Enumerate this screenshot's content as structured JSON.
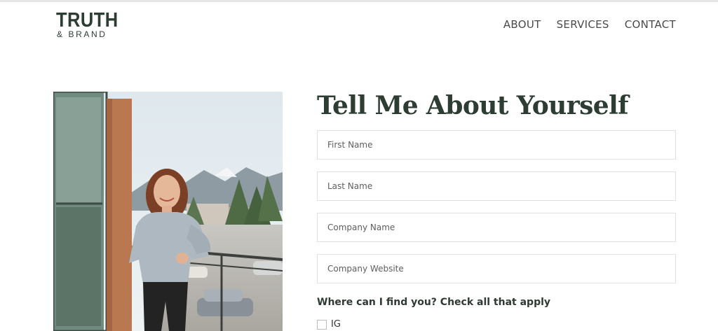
{
  "brand": {
    "name_main": "TRUTH",
    "name_sub": "& BRAND"
  },
  "nav": {
    "items": [
      {
        "label": "ABOUT"
      },
      {
        "label": "SERVICES"
      },
      {
        "label": "CONTACT"
      }
    ]
  },
  "form": {
    "title": "Tell Me About Yourself",
    "fields": {
      "first_name": {
        "placeholder": "First Name",
        "value": ""
      },
      "last_name": {
        "placeholder": "Last Name",
        "value": ""
      },
      "company_name": {
        "placeholder": "Company Name",
        "value": ""
      },
      "company_website": {
        "placeholder": "Company Website",
        "value": ""
      }
    },
    "question": "Where can I find you? Check all that apply",
    "options": [
      {
        "label": "IG",
        "checked": false
      }
    ]
  },
  "colors": {
    "brand_green": "#2e3d33",
    "field_border": "#e0e0e0",
    "nav_text": "#4a4a4a"
  },
  "icons": {
    "photo": "portrait-photo"
  }
}
